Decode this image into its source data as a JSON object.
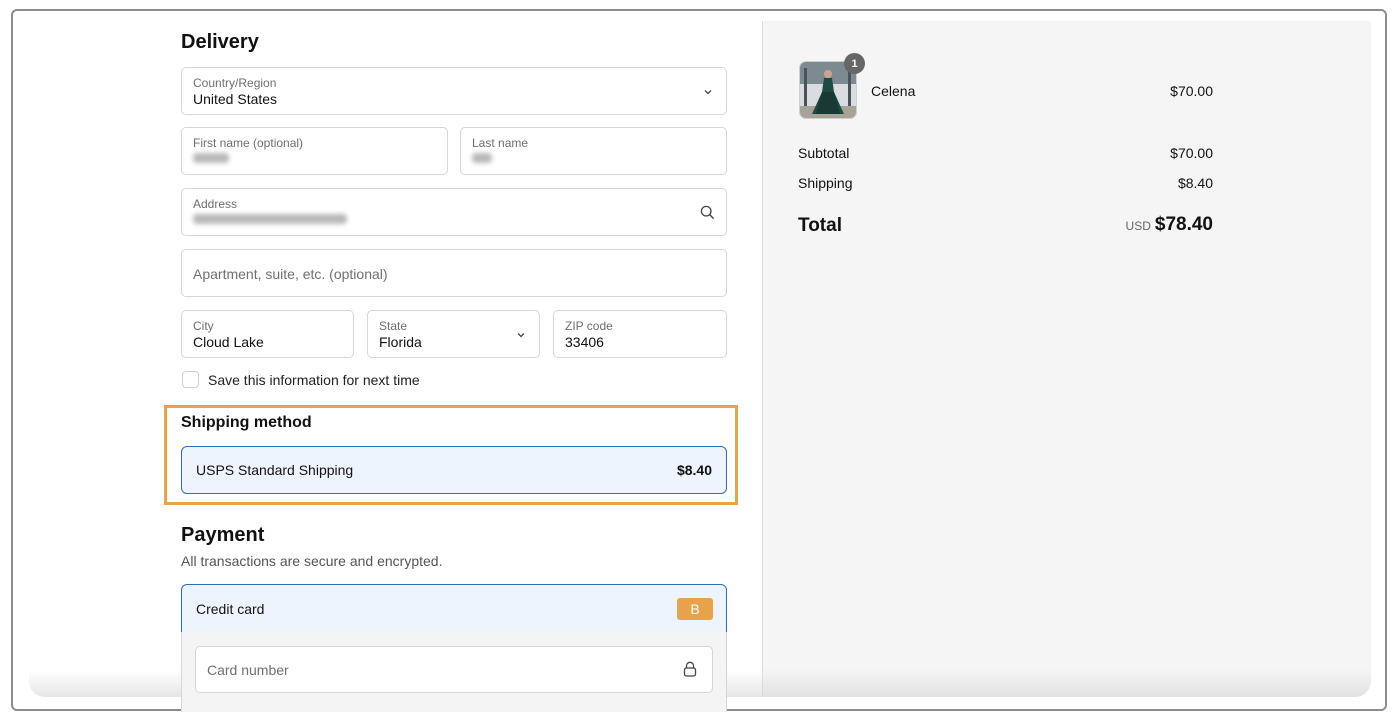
{
  "delivery": {
    "heading": "Delivery",
    "country": {
      "label": "Country/Region",
      "value": "United States"
    },
    "first_name": {
      "label": "First name (optional)"
    },
    "last_name": {
      "label": "Last name"
    },
    "address": {
      "label": "Address"
    },
    "apartment": {
      "placeholder": "Apartment, suite, etc. (optional)"
    },
    "city": {
      "label": "City",
      "value": "Cloud Lake"
    },
    "state": {
      "label": "State",
      "value": "Florida"
    },
    "zip": {
      "label": "ZIP code",
      "value": "33406"
    },
    "save_info_label": "Save this information for next time"
  },
  "shipping": {
    "heading": "Shipping method",
    "option_name": "USPS Standard Shipping",
    "option_price": "$8.40"
  },
  "payment": {
    "heading": "Payment",
    "subtitle": "All transactions are secure and encrypted.",
    "method_label": "Credit card",
    "brand_badge": "B",
    "card_number_placeholder": "Card number"
  },
  "summary": {
    "item": {
      "name": "Celena",
      "price": "$70.00",
      "quantity": "1"
    },
    "subtotal_label": "Subtotal",
    "subtotal_value": "$70.00",
    "shipping_label": "Shipping",
    "shipping_value": "$8.40",
    "total_label": "Total",
    "currency": "USD",
    "total_value": "$78.40"
  },
  "colors": {
    "accent_blue": "#2f6db7",
    "highlight_orange": "#e8a24a",
    "selected_bg": "#eef4fd",
    "summary_bg": "#f5f5f5"
  }
}
